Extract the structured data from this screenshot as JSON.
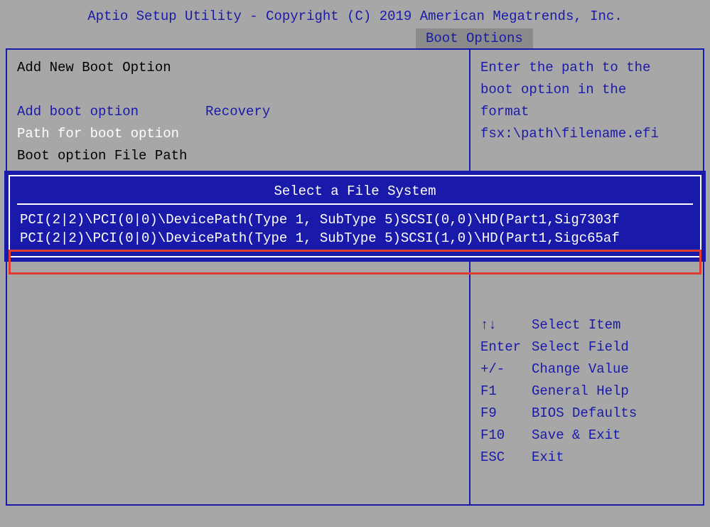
{
  "header": "Aptio Setup Utility - Copyright (C) 2019 American Megatrends, Inc.",
  "tab": {
    "label": "Boot Options"
  },
  "left": {
    "title": "Add New Boot Option",
    "add_label": "Add boot option",
    "add_value": "Recovery",
    "path_label": "Path for boot option",
    "filepath_label": "Boot option File Path"
  },
  "help": [
    "Enter the path to the",
    "boot option in the",
    "format",
    "fsx:\\path\\filename.efi"
  ],
  "dialog": {
    "title": "Select a File System",
    "items": [
      "PCI(2|2)\\PCI(0|0)\\DevicePath(Type 1, SubType 5)SCSI(0,0)\\HD(Part1,Sig7303f",
      "PCI(2|2)\\PCI(0|0)\\DevicePath(Type 1, SubType 5)SCSI(1,0)\\HD(Part1,Sigc65af"
    ]
  },
  "keys": [
    {
      "k": "↑↓",
      "d": "Select Item"
    },
    {
      "k": "Enter",
      "d": "Select Field"
    },
    {
      "k": "+/-",
      "d": "Change Value"
    },
    {
      "k": "F1",
      "d": "General Help"
    },
    {
      "k": "F9",
      "d": "BIOS Defaults"
    },
    {
      "k": "F10",
      "d": "Save & Exit"
    },
    {
      "k": "ESC",
      "d": "Exit"
    }
  ]
}
